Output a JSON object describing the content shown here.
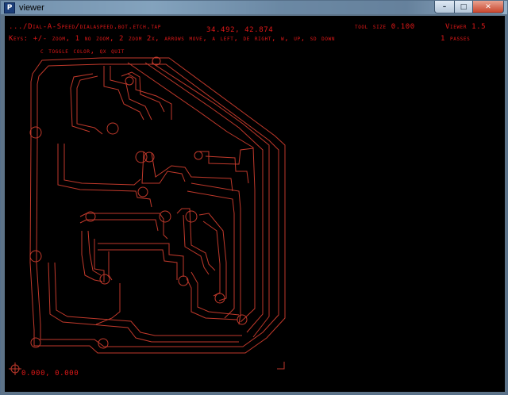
{
  "window": {
    "title": "viewer",
    "app_icon": "P",
    "buttons": {
      "minimize": "–",
      "maximize": "□",
      "close": "✕"
    }
  },
  "viewer": {
    "file_path": ".../Dial-A-Speed/dialaspeed.bot.etch.tap",
    "cursor_coords": "34.492, 42.874",
    "tool_size": "tool size  0.100",
    "version": "Viewer 1.5",
    "keys_help": "Keys: +/- zoom, 1 no zoom, 2 zoom 2x, arrows move, a left, de right, w, up, sd down",
    "passes": "1 passes",
    "keys_help_2": "c toggle color, qx quit",
    "origin_coords": "0.000, 0.000"
  },
  "colors": {
    "trace": "#c0392b",
    "hud_text": "#e01818",
    "background": "#000000"
  }
}
